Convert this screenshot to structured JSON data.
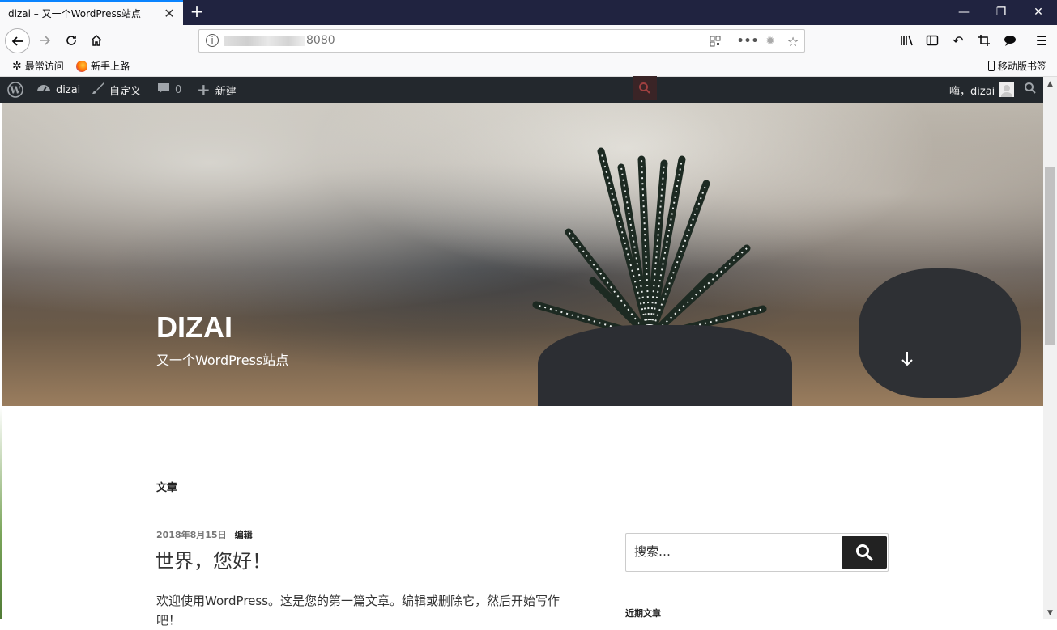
{
  "browser": {
    "tab_title": "dizai – 又一个WordPress站点",
    "url_visible_suffix": "8080",
    "bookmarks": [
      {
        "label": "最常访问",
        "icon": "gear-icon"
      },
      {
        "label": "新手上路",
        "icon": "firefox-icon"
      }
    ],
    "mobile_bookmarks_label": "移动版书签"
  },
  "admin_bar": {
    "site_name": "dizai",
    "customize": "自定义",
    "comments_count": "0",
    "new": "新建",
    "greeting": "嗨，dizai"
  },
  "hero": {
    "site_title": "DIZAI",
    "site_description": "又一个WordPress站点"
  },
  "content": {
    "section_heading": "文章",
    "post": {
      "date": "2018年8月15日",
      "edit_label": "编辑",
      "title": "世界，您好！",
      "excerpt": "欢迎使用WordPress。这是您的第一篇文章。编辑或删除它，然后开始写作吧！"
    }
  },
  "sidebar": {
    "search_placeholder": "搜索…",
    "recent_posts_heading": "近期文章"
  }
}
